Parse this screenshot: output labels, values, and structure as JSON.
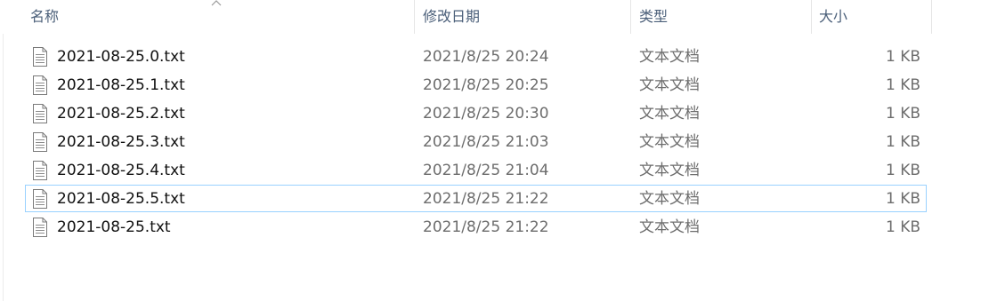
{
  "columns": {
    "name": "名称",
    "date": "修改日期",
    "type": "类型",
    "size": "大小"
  },
  "files": [
    {
      "name": "2021-08-25.0.txt",
      "date": "2021/8/25 20:24",
      "type": "文本文档",
      "size": "1 KB"
    },
    {
      "name": "2021-08-25.1.txt",
      "date": "2021/8/25 20:25",
      "type": "文本文档",
      "size": "1 KB"
    },
    {
      "name": "2021-08-25.2.txt",
      "date": "2021/8/25 20:30",
      "type": "文本文档",
      "size": "1 KB"
    },
    {
      "name": "2021-08-25.3.txt",
      "date": "2021/8/25 21:03",
      "type": "文本文档",
      "size": "1 KB"
    },
    {
      "name": "2021-08-25.4.txt",
      "date": "2021/8/25 21:04",
      "type": "文本文档",
      "size": "1 KB"
    },
    {
      "name": "2021-08-25.5.txt",
      "date": "2021/8/25 21:22",
      "type": "文本文档",
      "size": "1 KB"
    },
    {
      "name": "2021-08-25.txt",
      "date": "2021/8/25 21:22",
      "type": "文本文档",
      "size": "1 KB"
    }
  ],
  "selected_index": 5,
  "colors": {
    "selection_border": "#99d1ff",
    "header_text": "#4c607a",
    "name_text": "#111111",
    "detail_text": "#6d6d6d"
  },
  "icons": {
    "file": "text-file-icon",
    "sort": "sort-ascending-icon"
  }
}
